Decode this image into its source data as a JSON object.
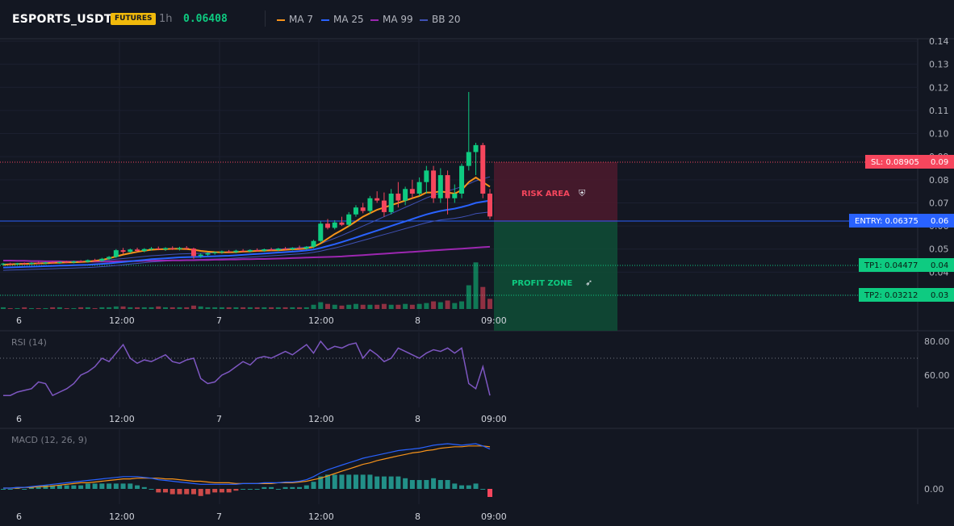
{
  "header": {
    "symbol": "ESPORTS_USDT",
    "badge": "FUTURES",
    "timeframe": "1h",
    "price": "0.06408",
    "legend": [
      {
        "name": "MA 7",
        "color": "#f7931a"
      },
      {
        "name": "MA 25",
        "color": "#2962ff"
      },
      {
        "name": "MA 99",
        "color": "#9c27b0"
      },
      {
        "name": "BB 20",
        "color": "#3f51b5"
      }
    ]
  },
  "price_axis": [
    "0.14",
    "0.13",
    "0.12",
    "0.11",
    "0.10",
    "0.09",
    "0.08",
    "0.07",
    "0.06",
    "0.05",
    "0.04",
    "0.03"
  ],
  "levels": {
    "sl": "SL: 0.08905",
    "sl_axis": "0.09",
    "entry": "ENTRY: 0.06375",
    "entry_axis": "0.06",
    "tp1": "TP1: 0.04477",
    "tp1_axis": "0.04",
    "tp2": "TP2: 0.03212",
    "tp2_axis": "0.03",
    "risk_label": "RISK AREA",
    "profit_label": "PROFIT ZONE"
  },
  "time_axis": [
    "6",
    "12:00",
    "7",
    "12:00",
    "8",
    "09:00"
  ],
  "rsi": {
    "title": "RSI (14)",
    "levels": [
      "80.00",
      "60.00"
    ]
  },
  "macd": {
    "title": "MACD (12, 26, 9)",
    "levels": [
      "0.00"
    ]
  },
  "colors": {
    "bull": "#0ecb81",
    "bear": "#f6465d",
    "bg": "#131722",
    "grid": "#1e2230"
  },
  "chart_data": {
    "type": "candlestick",
    "series": [
      {
        "name": "price",
        "ohlc": [
          [
            0.0435,
            0.044,
            0.043,
            0.0437
          ],
          [
            0.0437,
            0.0441,
            0.0432,
            0.0434
          ],
          [
            0.0434,
            0.044,
            0.0431,
            0.0438
          ],
          [
            0.0438,
            0.0442,
            0.0433,
            0.0436
          ],
          [
            0.0436,
            0.0443,
            0.0432,
            0.044
          ],
          [
            0.044,
            0.0445,
            0.0436,
            0.0438
          ],
          [
            0.0438,
            0.0444,
            0.0434,
            0.0442
          ],
          [
            0.0442,
            0.0446,
            0.0437,
            0.044
          ],
          [
            0.044,
            0.0447,
            0.0436,
            0.0444
          ],
          [
            0.0444,
            0.0449,
            0.0439,
            0.0442
          ],
          [
            0.0442,
            0.045,
            0.0438,
            0.0447
          ],
          [
            0.0447,
            0.0452,
            0.0441,
            0.0445
          ],
          [
            0.0445,
            0.0455,
            0.0441,
            0.0452
          ],
          [
            0.0452,
            0.0458,
            0.0446,
            0.0449
          ],
          [
            0.0449,
            0.0462,
            0.0445,
            0.0458
          ],
          [
            0.0458,
            0.047,
            0.0452,
            0.0466
          ],
          [
            0.0466,
            0.05,
            0.0462,
            0.0495
          ],
          [
            0.0495,
            0.0505,
            0.0478,
            0.0488
          ],
          [
            0.0488,
            0.0502,
            0.0482,
            0.0498
          ],
          [
            0.0498,
            0.0506,
            0.0488,
            0.0492
          ],
          [
            0.0492,
            0.0504,
            0.0486,
            0.05
          ],
          [
            0.05,
            0.0509,
            0.0493,
            0.0503
          ],
          [
            0.0503,
            0.0511,
            0.0495,
            0.0499
          ],
          [
            0.0499,
            0.0508,
            0.0492,
            0.0504
          ],
          [
            0.0504,
            0.0512,
            0.0496,
            0.05
          ],
          [
            0.05,
            0.051,
            0.0494,
            0.0505
          ],
          [
            0.0505,
            0.0513,
            0.0497,
            0.0502
          ],
          [
            0.0502,
            0.0506,
            0.0458,
            0.047
          ],
          [
            0.047,
            0.0482,
            0.0462,
            0.0476
          ],
          [
            0.0476,
            0.0486,
            0.047,
            0.0482
          ],
          [
            0.0482,
            0.049,
            0.0476,
            0.0486
          ],
          [
            0.0486,
            0.0494,
            0.048,
            0.049
          ],
          [
            0.049,
            0.0496,
            0.0483,
            0.0487
          ],
          [
            0.0487,
            0.0497,
            0.0482,
            0.0493
          ],
          [
            0.0493,
            0.05,
            0.0487,
            0.049
          ],
          [
            0.049,
            0.0499,
            0.0485,
            0.0496
          ],
          [
            0.0496,
            0.0503,
            0.0489,
            0.0493
          ],
          [
            0.0493,
            0.0502,
            0.0488,
            0.0499
          ],
          [
            0.0499,
            0.0506,
            0.0492,
            0.0496
          ],
          [
            0.0496,
            0.0505,
            0.0491,
            0.0502
          ],
          [
            0.0502,
            0.0509,
            0.0495,
            0.0499
          ],
          [
            0.0499,
            0.0508,
            0.0494,
            0.0505
          ],
          [
            0.0505,
            0.0515,
            0.0498,
            0.0502
          ],
          [
            0.0502,
            0.0513,
            0.0497,
            0.051
          ],
          [
            0.051,
            0.054,
            0.0504,
            0.0535
          ],
          [
            0.0535,
            0.062,
            0.0528,
            0.061
          ],
          [
            0.061,
            0.063,
            0.0585,
            0.0592
          ],
          [
            0.0592,
            0.0625,
            0.0585,
            0.0615
          ],
          [
            0.0615,
            0.064,
            0.06,
            0.0605
          ],
          [
            0.0605,
            0.066,
            0.0598,
            0.065
          ],
          [
            0.065,
            0.069,
            0.064,
            0.068
          ],
          [
            0.068,
            0.07,
            0.0655,
            0.0665
          ],
          [
            0.0665,
            0.073,
            0.0652,
            0.072
          ],
          [
            0.072,
            0.075,
            0.07,
            0.071
          ],
          [
            0.071,
            0.0745,
            0.064,
            0.066
          ],
          [
            0.066,
            0.076,
            0.065,
            0.074
          ],
          [
            0.074,
            0.079,
            0.068,
            0.071
          ],
          [
            0.071,
            0.077,
            0.069,
            0.076
          ],
          [
            0.076,
            0.08,
            0.072,
            0.074
          ],
          [
            0.074,
            0.081,
            0.073,
            0.079
          ],
          [
            0.079,
            0.086,
            0.074,
            0.084
          ],
          [
            0.084,
            0.086,
            0.07,
            0.072
          ],
          [
            0.072,
            0.085,
            0.07,
            0.082
          ],
          [
            0.082,
            0.084,
            0.065,
            0.072
          ],
          [
            0.072,
            0.078,
            0.07,
            0.074
          ],
          [
            0.074,
            0.087,
            0.072,
            0.086
          ],
          [
            0.086,
            0.118,
            0.084,
            0.092
          ],
          [
            0.092,
            0.096,
            0.082,
            0.095
          ],
          [
            0.095,
            0.096,
            0.072,
            0.074
          ],
          [
            0.074,
            0.076,
            0.063,
            0.0641
          ]
        ]
      },
      {
        "name": "MA 7",
        "values": [
          0.0432,
          0.0434,
          0.0435,
          0.0436,
          0.0437,
          0.0438,
          0.0439,
          0.044,
          0.0441,
          0.0442,
          0.0443,
          0.0444,
          0.0446,
          0.0449,
          0.0453,
          0.046,
          0.0468,
          0.0476,
          0.0482,
          0.0488,
          0.0493,
          0.0497,
          0.0499,
          0.05,
          0.0501,
          0.0501,
          0.05,
          0.0497,
          0.0492,
          0.0489,
          0.0487,
          0.0486,
          0.0486,
          0.0487,
          0.0489,
          0.049,
          0.0492,
          0.0493,
          0.0494,
          0.0495,
          0.0497,
          0.0499,
          0.05,
          0.0503,
          0.051,
          0.0525,
          0.0545,
          0.0565,
          0.0582,
          0.06,
          0.062,
          0.064,
          0.0655,
          0.067,
          0.068,
          0.069,
          0.07,
          0.071,
          0.072,
          0.073,
          0.0745,
          0.0745,
          0.075,
          0.0745,
          0.074,
          0.0755,
          0.079,
          0.081,
          0.079,
          0.077
        ]
      },
      {
        "name": "MA 25",
        "values": [
          0.042,
          0.0421,
          0.0422,
          0.0423,
          0.0424,
          0.0425,
          0.0426,
          0.0427,
          0.0428,
          0.0429,
          0.043,
          0.0431,
          0.0432,
          0.0434,
          0.0436,
          0.0438,
          0.0441,
          0.0444,
          0.0447,
          0.045,
          0.0453,
          0.0456,
          0.0458,
          0.046,
          0.0462,
          0.0464,
          0.0465,
          0.0466,
          0.0467,
          0.0468,
          0.0469,
          0.047,
          0.0471,
          0.0473,
          0.0475,
          0.0477,
          0.0479,
          0.0481,
          0.0483,
          0.0485,
          0.0487,
          0.0489,
          0.0491,
          0.0494,
          0.0498,
          0.0505,
          0.0513,
          0.0521,
          0.053,
          0.054,
          0.055,
          0.056,
          0.057,
          0.058,
          0.059,
          0.06,
          0.061,
          0.062,
          0.063,
          0.064,
          0.065,
          0.0658,
          0.0665,
          0.067,
          0.0675,
          0.0682,
          0.069,
          0.07,
          0.0705,
          0.071
        ]
      },
      {
        "name": "MA 99",
        "values": [
          0.045,
          0.045,
          0.0449,
          0.0449,
          0.0448,
          0.0448,
          0.0447,
          0.0447,
          0.0447,
          0.0446,
          0.0446,
          0.0446,
          0.0446,
          0.0446,
          0.0446,
          0.0446,
          0.0447,
          0.0447,
          0.0448,
          0.0448,
          0.0449,
          0.0449,
          0.045,
          0.045,
          0.0451,
          0.0451,
          0.0452,
          0.0452,
          0.0453,
          0.0453,
          0.0454,
          0.0454,
          0.0455,
          0.0455,
          0.0456,
          0.0456,
          0.0457,
          0.0457,
          0.0458,
          0.0459,
          0.046,
          0.0461,
          0.0462,
          0.0463,
          0.0464,
          0.0465,
          0.0466,
          0.0467,
          0.0468,
          0.047,
          0.0472,
          0.0474,
          0.0476,
          0.0478,
          0.048,
          0.0482,
          0.0484,
          0.0486,
          0.0488,
          0.049,
          0.0492,
          0.0494,
          0.0496,
          0.0498,
          0.05,
          0.0502,
          0.0504,
          0.0506,
          0.0508,
          0.051
        ]
      }
    ],
    "volume": [
      2,
      1,
      1,
      2,
      1,
      1,
      1,
      2,
      2,
      1,
      1,
      2,
      2,
      1,
      2,
      2,
      3,
      3,
      2,
      2,
      2,
      2,
      3,
      2,
      2,
      2,
      2,
      4,
      3,
      2,
      2,
      2,
      2,
      2,
      2,
      2,
      2,
      2,
      2,
      2,
      2,
      2,
      2,
      2,
      5,
      8,
      6,
      5,
      4,
      5,
      6,
      5,
      5,
      5,
      6,
      5,
      5,
      6,
      5,
      6,
      7,
      9,
      8,
      10,
      7,
      9,
      28,
      55,
      26,
      12
    ],
    "rsi": [
      48,
      48,
      50,
      51,
      52,
      56,
      55,
      48,
      50,
      52,
      55,
      60,
      62,
      65,
      70,
      68,
      73,
      78,
      70,
      67,
      69,
      68,
      70,
      72,
      68,
      67,
      69,
      70,
      58,
      55,
      56,
      60,
      62,
      65,
      68,
      66,
      70,
      71,
      70,
      72,
      74,
      72,
      75,
      78,
      73,
      80,
      75,
      77,
      76,
      78,
      79,
      70,
      75,
      72,
      68,
      70,
      76,
      74,
      72,
      70,
      73,
      75,
      74,
      76,
      73,
      76,
      55,
      52,
      65,
      48
    ],
    "macd": {
      "macd": [
        0.0001,
        0.0001,
        0.0002,
        0.0002,
        0.0003,
        0.0004,
        0.0005,
        0.0006,
        0.0007,
        0.0008,
        0.0009,
        0.001,
        0.0011,
        0.0012,
        0.0013,
        0.0014,
        0.0015,
        0.0016,
        0.0016,
        0.0016,
        0.0015,
        0.0014,
        0.0012,
        0.0011,
        0.001,
        0.0009,
        0.0008,
        0.0007,
        0.0006,
        0.0006,
        0.0006,
        0.0006,
        0.0006,
        0.0006,
        0.0007,
        0.0007,
        0.0007,
        0.0008,
        0.0008,
        0.0008,
        0.0009,
        0.0009,
        0.001,
        0.0012,
        0.0016,
        0.0021,
        0.0025,
        0.0028,
        0.0031,
        0.0034,
        0.0037,
        0.004,
        0.0042,
        0.0044,
        0.0046,
        0.0048,
        0.005,
        0.0051,
        0.0052,
        0.0053,
        0.0055,
        0.0057,
        0.0058,
        0.0059,
        0.0058,
        0.0057,
        0.0058,
        0.0059,
        0.0056,
        0.0052
      ],
      "signal": [
        0.0001,
        0.0001,
        0.0001,
        0.0002,
        0.0002,
        0.0003,
        0.0003,
        0.0004,
        0.0005,
        0.0006,
        0.0007,
        0.0008,
        0.0008,
        0.0009,
        0.001,
        0.0011,
        0.0012,
        0.0013,
        0.0013,
        0.0014,
        0.0014,
        0.0014,
        0.0014,
        0.0013,
        0.0013,
        0.0012,
        0.0011,
        0.001,
        0.001,
        0.0009,
        0.0008,
        0.0008,
        0.0008,
        0.0007,
        0.0007,
        0.0007,
        0.0007,
        0.0007,
        0.0007,
        0.0008,
        0.0008,
        0.0008,
        0.0009,
        0.001,
        0.0012,
        0.0014,
        0.0017,
        0.002,
        0.0023,
        0.0026,
        0.0029,
        0.0032,
        0.0034,
        0.0037,
        0.0039,
        0.0041,
        0.0043,
        0.0045,
        0.0047,
        0.0048,
        0.005,
        0.0051,
        0.0053,
        0.0054,
        0.0055,
        0.0055,
        0.0056,
        0.0056,
        0.0056,
        0.0055
      ]
    }
  }
}
